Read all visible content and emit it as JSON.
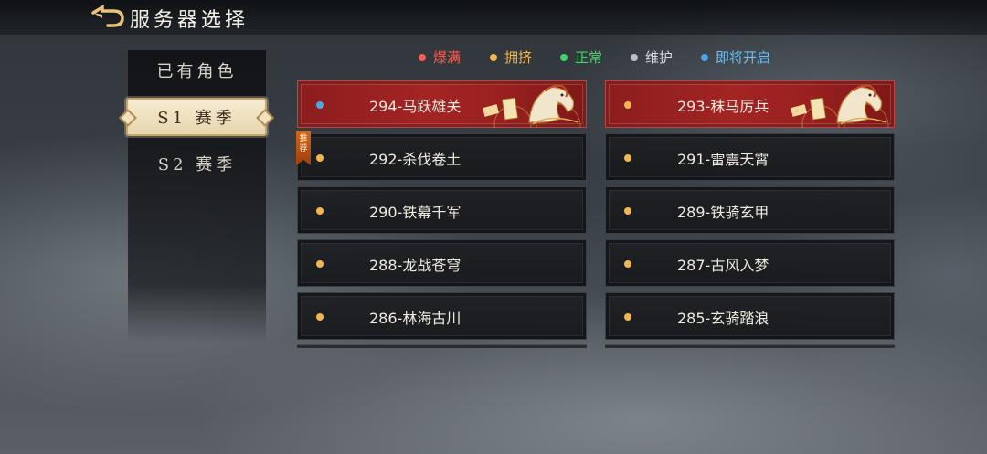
{
  "header": {
    "title": "服务器选择",
    "back_icon": "back-arrow-icon"
  },
  "sidebar": {
    "tabs": [
      {
        "label": "已有角色",
        "active": false
      },
      {
        "label": "S1 赛季",
        "active": true
      },
      {
        "label": "S2 赛季",
        "active": false
      }
    ]
  },
  "legend": [
    {
      "label": "爆满",
      "color": "#ff5a4e"
    },
    {
      "label": "拥挤",
      "color": "#f2b64a"
    },
    {
      "label": "正常",
      "color": "#3fd46a"
    },
    {
      "label": "维护",
      "color": "#b9bfc8"
    },
    {
      "label": "即将开启",
      "color": "#4aa8e8"
    }
  ],
  "recommend_label": "推荐",
  "servers": [
    {
      "name": "294-马跃雄关",
      "status_color": "#4aa8e8",
      "featured": true
    },
    {
      "name": "293-秣马厉兵",
      "status_color": "#f2b64a",
      "featured": true
    },
    {
      "name": "292-杀伐卷土",
      "status_color": "#f2b64a",
      "featured": false,
      "recommended": true
    },
    {
      "name": "291-雷震天霄",
      "status_color": "#f2b64a",
      "featured": false
    },
    {
      "name": "290-铁幕千军",
      "status_color": "#f2b64a",
      "featured": false
    },
    {
      "name": "289-铁骑玄甲",
      "status_color": "#f2b64a",
      "featured": false
    },
    {
      "name": "288-龙战苍穹",
      "status_color": "#f2b64a",
      "featured": false
    },
    {
      "name": "287-古风入梦",
      "status_color": "#f2b64a",
      "featured": false
    },
    {
      "name": "286-林海古川",
      "status_color": "#f2b64a",
      "featured": false
    },
    {
      "name": "285-玄骑踏浪",
      "status_color": "#f2b64a",
      "featured": false
    }
  ]
}
